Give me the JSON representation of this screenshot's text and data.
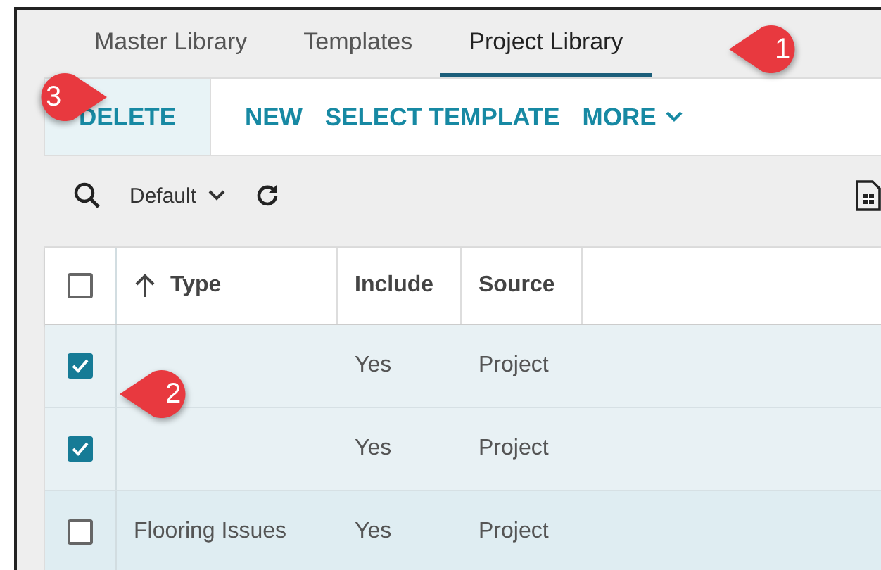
{
  "tabs": [
    {
      "label": "Master Library",
      "selected": false
    },
    {
      "label": "Templates",
      "selected": false
    },
    {
      "label": "Project Library",
      "selected": true
    }
  ],
  "actions": [
    {
      "label": "DELETE",
      "highlighted": true,
      "dropdown": false
    },
    {
      "label": "NEW",
      "highlighted": false,
      "dropdown": false
    },
    {
      "label": "SELECT TEMPLATE",
      "highlighted": false,
      "dropdown": false
    },
    {
      "label": "MORE",
      "highlighted": false,
      "dropdown": true
    }
  ],
  "view": {
    "label": "Default"
  },
  "table": {
    "select_all": {
      "checked": false
    },
    "columns": [
      {
        "label": "Type",
        "sorted": true
      },
      {
        "label": "Include",
        "sorted": false
      },
      {
        "label": "Source",
        "sorted": false
      }
    ],
    "rows": [
      {
        "checked": true,
        "hovered": false,
        "cells": [
          "",
          "Yes",
          "Project"
        ]
      },
      {
        "checked": true,
        "hovered": false,
        "cells": [
          "",
          "Yes",
          "Project"
        ]
      },
      {
        "checked": false,
        "hovered": true,
        "cells": [
          "Flooring Issues",
          "Yes",
          "Project"
        ]
      }
    ]
  },
  "callouts": [
    {
      "label": "1"
    },
    {
      "label": "2"
    },
    {
      "label": "3"
    }
  ]
}
